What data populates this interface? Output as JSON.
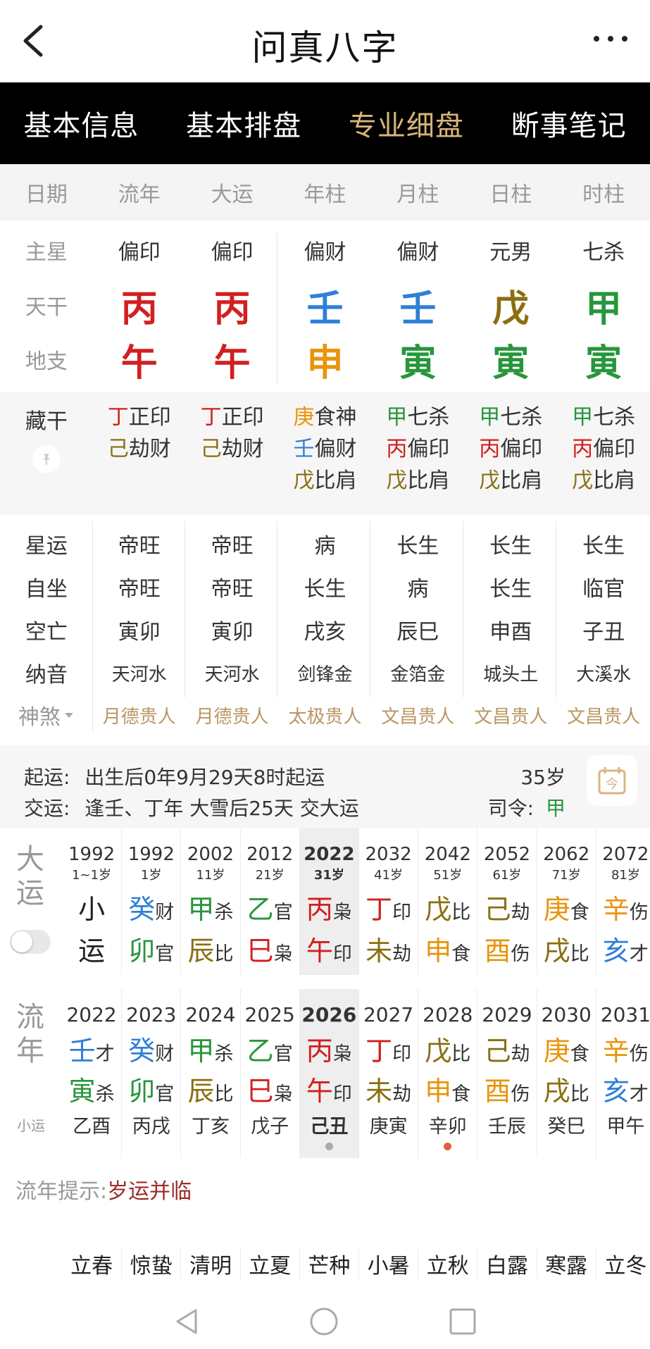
{
  "app": {
    "title": "问真八字"
  },
  "tabs": [
    {
      "label": "基本信息",
      "active": false
    },
    {
      "label": "基本排盘",
      "active": false
    },
    {
      "label": "专业细盘",
      "active": true
    },
    {
      "label": "断事笔记",
      "active": false
    }
  ],
  "columns": [
    "日期",
    "流年",
    "大运",
    "年柱",
    "月柱",
    "日柱",
    "时柱"
  ],
  "main_star": {
    "label": "主星",
    "values": [
      "偏印",
      "偏印",
      "偏财",
      "偏财",
      "元男",
      "七杀"
    ]
  },
  "heaven_stem": {
    "label": "天干",
    "values": [
      "丙",
      "丙",
      "壬",
      "壬",
      "戊",
      "甲"
    ],
    "colors": [
      "#d0201f",
      "#d0201f",
      "#2f7fd6",
      "#2f7fd6",
      "#8a6e10",
      "#27963c"
    ]
  },
  "earth_branch": {
    "label": "地支",
    "values": [
      "午",
      "午",
      "申",
      "寅",
      "寅",
      "寅"
    ],
    "colors": [
      "#d0201f",
      "#d0201f",
      "#e8940c",
      "#27963c",
      "#27963c",
      "#27963c"
    ]
  },
  "hidden_stems": {
    "label": "藏干",
    "columns": [
      [
        {
          "stem": "丁",
          "god": "正印",
          "color": "#d0201f"
        },
        {
          "stem": "己",
          "god": "劫财",
          "color": "#8a6e10"
        }
      ],
      [
        {
          "stem": "丁",
          "god": "正印",
          "color": "#d0201f"
        },
        {
          "stem": "己",
          "god": "劫财",
          "color": "#8a6e10"
        }
      ],
      [
        {
          "stem": "庚",
          "god": "食神",
          "color": "#e8940c"
        },
        {
          "stem": "壬",
          "god": "偏财",
          "color": "#2f7fd6"
        },
        {
          "stem": "戊",
          "god": "比肩",
          "color": "#8a6e10"
        }
      ],
      [
        {
          "stem": "甲",
          "god": "七杀",
          "color": "#27963c"
        },
        {
          "stem": "丙",
          "god": "偏印",
          "color": "#d0201f"
        },
        {
          "stem": "戊",
          "god": "比肩",
          "color": "#8a6e10"
        }
      ],
      [
        {
          "stem": "甲",
          "god": "七杀",
          "color": "#27963c"
        },
        {
          "stem": "丙",
          "god": "偏印",
          "color": "#d0201f"
        },
        {
          "stem": "戊",
          "god": "比肩",
          "color": "#8a6e10"
        }
      ],
      [
        {
          "stem": "甲",
          "god": "七杀",
          "color": "#27963c"
        },
        {
          "stem": "丙",
          "god": "偏印",
          "color": "#d0201f"
        },
        {
          "stem": "戊",
          "god": "比肩",
          "color": "#8a6e10"
        }
      ]
    ]
  },
  "star_luck": {
    "label": "星运",
    "values": [
      "帝旺",
      "帝旺",
      "病",
      "长生",
      "长生",
      "长生"
    ]
  },
  "self_seat": {
    "label": "自坐",
    "values": [
      "帝旺",
      "帝旺",
      "长生",
      "病",
      "长生",
      "临官"
    ]
  },
  "void": {
    "label": "空亡",
    "values": [
      "寅卯",
      "寅卯",
      "戌亥",
      "辰巳",
      "申酉",
      "子丑"
    ]
  },
  "nayin": {
    "label": "纳音",
    "values": [
      "天河水",
      "天河水",
      "剑锋金",
      "金箔金",
      "城头土",
      "大溪水"
    ]
  },
  "shensha": {
    "label": "神煞",
    "values": [
      "月德贵人",
      "月德贵人",
      "太极贵人",
      "文昌贵人",
      "文昌贵人",
      "文昌贵人"
    ]
  },
  "qiyun": {
    "start_label": "起运:",
    "start_text": "出生后0年9月29天8时起运",
    "age": "35岁",
    "change_label": "交运:",
    "change_text": "逢壬、丁年 大雪后25天 交大运",
    "siling_label": "司令:",
    "siling_value": "甲"
  },
  "dayun": {
    "label_1": "大",
    "label_2": "运",
    "selected_index": 4,
    "items": [
      {
        "year": "1992",
        "age": "1~1岁",
        "stem": "小",
        "stem_god": "",
        "branch": "运",
        "branch_god": "",
        "stem_color": "#222222",
        "branch_color": "#222222"
      },
      {
        "year": "1992",
        "age": "1岁",
        "stem": "癸",
        "stem_god": "财",
        "branch": "卯",
        "branch_god": "官",
        "stem_color": "#2f7fd6",
        "branch_color": "#27963c"
      },
      {
        "year": "2002",
        "age": "11岁",
        "stem": "甲",
        "stem_god": "杀",
        "branch": "辰",
        "branch_god": "比",
        "stem_color": "#27963c",
        "branch_color": "#8a6e10"
      },
      {
        "year": "2012",
        "age": "21岁",
        "stem": "乙",
        "stem_god": "官",
        "branch": "巳",
        "branch_god": "枭",
        "stem_color": "#27963c",
        "branch_color": "#d0201f"
      },
      {
        "year": "2022",
        "age": "31岁",
        "stem": "丙",
        "stem_god": "枭",
        "branch": "午",
        "branch_god": "印",
        "stem_color": "#d0201f",
        "branch_color": "#d0201f"
      },
      {
        "year": "2032",
        "age": "41岁",
        "stem": "丁",
        "stem_god": "印",
        "branch": "未",
        "branch_god": "劫",
        "stem_color": "#d0201f",
        "branch_color": "#8a6e10"
      },
      {
        "year": "2042",
        "age": "51岁",
        "stem": "戊",
        "stem_god": "比",
        "branch": "申",
        "branch_god": "食",
        "stem_color": "#8a6e10",
        "branch_color": "#e8940c"
      },
      {
        "year": "2052",
        "age": "61岁",
        "stem": "己",
        "stem_god": "劫",
        "branch": "酉",
        "branch_god": "伤",
        "stem_color": "#8a6e10",
        "branch_color": "#e8940c"
      },
      {
        "year": "2062",
        "age": "71岁",
        "stem": "庚",
        "stem_god": "食",
        "branch": "戌",
        "branch_god": "比",
        "stem_color": "#e8940c",
        "branch_color": "#8a6e10"
      },
      {
        "year": "2072",
        "age": "81岁",
        "stem": "辛",
        "stem_god": "伤",
        "branch": "亥",
        "branch_god": "才",
        "stem_color": "#e8940c",
        "branch_color": "#2f7fd6"
      }
    ]
  },
  "liunian": {
    "label_1": "流",
    "label_2": "年",
    "sub_label": "小运",
    "selected_index": 4,
    "items": [
      {
        "year": "2022",
        "stem": "壬",
        "stem_god": "才",
        "branch": "寅",
        "branch_god": "杀",
        "xiaoyun": "乙酉",
        "stem_color": "#2f7fd6",
        "branch_color": "#27963c"
      },
      {
        "year": "2023",
        "stem": "癸",
        "stem_god": "财",
        "branch": "卯",
        "branch_god": "官",
        "xiaoyun": "丙戌",
        "stem_color": "#2f7fd6",
        "branch_color": "#27963c"
      },
      {
        "year": "2024",
        "stem": "甲",
        "stem_god": "杀",
        "branch": "辰",
        "branch_god": "比",
        "xiaoyun": "丁亥",
        "stem_color": "#27963c",
        "branch_color": "#8a6e10"
      },
      {
        "year": "2025",
        "stem": "乙",
        "stem_god": "官",
        "branch": "巳",
        "branch_god": "枭",
        "xiaoyun": "戊子",
        "stem_color": "#27963c",
        "branch_color": "#d0201f"
      },
      {
        "year": "2026",
        "stem": "丙",
        "stem_god": "枭",
        "branch": "午",
        "branch_god": "印",
        "xiaoyun": "己丑",
        "stem_color": "#d0201f",
        "branch_color": "#d0201f"
      },
      {
        "year": "2027",
        "stem": "丁",
        "stem_god": "印",
        "branch": "未",
        "branch_god": "劫",
        "xiaoyun": "庚寅",
        "stem_color": "#d0201f",
        "branch_color": "#8a6e10"
      },
      {
        "year": "2028",
        "stem": "戊",
        "stem_god": "比",
        "branch": "申",
        "branch_god": "食",
        "xiaoyun": "辛卯",
        "stem_color": "#8a6e10",
        "branch_color": "#e8940c"
      },
      {
        "year": "2029",
        "stem": "己",
        "stem_god": "劫",
        "branch": "酉",
        "branch_god": "伤",
        "xiaoyun": "壬辰",
        "stem_color": "#8a6e10",
        "branch_color": "#e8940c"
      },
      {
        "year": "2030",
        "stem": "庚",
        "stem_god": "食",
        "branch": "戌",
        "branch_god": "比",
        "xiaoyun": "癸巳",
        "stem_color": "#e8940c",
        "branch_color": "#8a6e10"
      },
      {
        "year": "2031",
        "stem": "辛",
        "stem_god": "伤",
        "branch": "亥",
        "branch_god": "才",
        "xiaoyun": "甲午",
        "stem_color": "#e8940c",
        "branch_color": "#2f7fd6"
      }
    ]
  },
  "hint": {
    "label": "流年提示:",
    "value": "岁运并临"
  },
  "jieqi": [
    "立春",
    "惊蛰",
    "清明",
    "立夏",
    "芒种",
    "小暑",
    "立秋",
    "白露",
    "寒露",
    "立冬"
  ],
  "icons": {
    "back": "chevron-left-icon",
    "more": "more-dots-icon",
    "pin": "pin-icon",
    "calendar": "calendar-today-icon",
    "nav_back": "triangle-back-icon",
    "nav_home": "circle-home-icon",
    "nav_recent": "square-recent-icon"
  }
}
